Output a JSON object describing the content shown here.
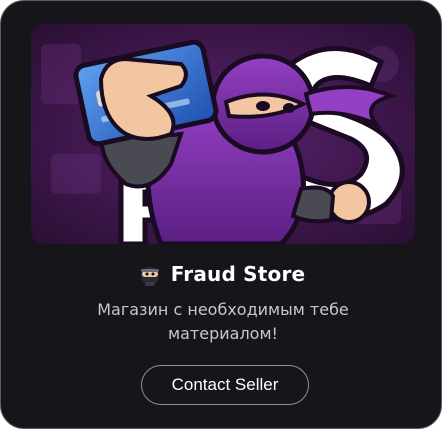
{
  "store": {
    "title": "Fraud Store",
    "title_icon": "ninja-emoji-icon",
    "description": "Магазин с необходимым тебе\nматериалом!",
    "banner": {
      "image": "ninja-mascot-holding-credit-card",
      "logo_letters": "FS",
      "colors": {
        "background": "#3b1745",
        "ninja": "#7a2fa3",
        "card": "#2f6fd6"
      }
    }
  },
  "actions": {
    "contact_label": "Contact Seller"
  },
  "colors": {
    "card_background": "#16161a",
    "card_border": "#5a5a60",
    "text_primary": "#ffffff",
    "text_secondary": "#c8c8cc"
  }
}
